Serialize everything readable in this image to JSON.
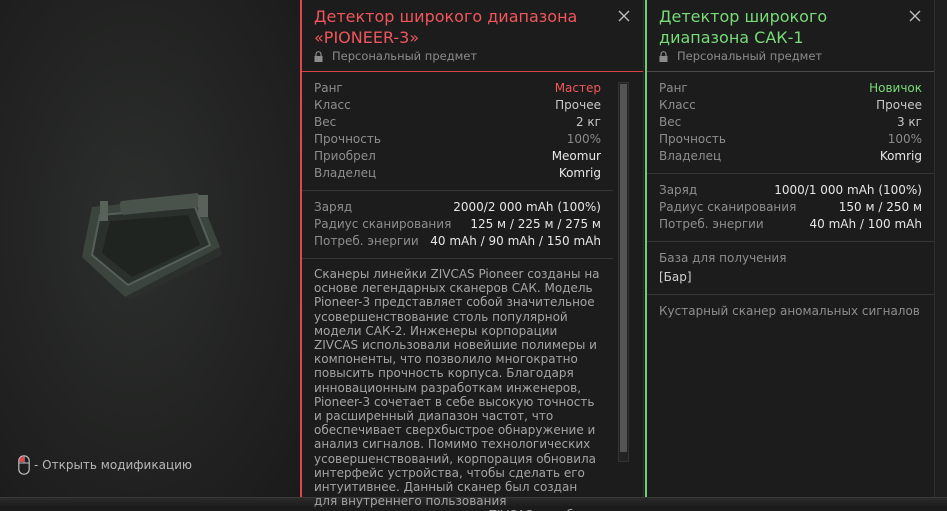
{
  "hint": {
    "text": "- Открыть модификацию"
  },
  "panel_a": {
    "title": "Детектор широкого диапазона «PIONEER-3»",
    "personal": "Персональный предмет",
    "stats1": [
      {
        "k": "Ранг",
        "v": "Мастер",
        "tone": "red"
      },
      {
        "k": "Класс",
        "v": "Прочее",
        "tone": "normal"
      },
      {
        "k": "Вес",
        "v": "2 кг",
        "tone": "normal"
      },
      {
        "k": "Прочность",
        "v": "100%",
        "tone": "dim"
      },
      {
        "k": "Приобрел",
        "v": "Meomur",
        "tone": "bright"
      },
      {
        "k": "Владелец",
        "v": "Komrig",
        "tone": "bright"
      }
    ],
    "stats2": [
      {
        "k": "Заряд",
        "v": "2000/2 000 mAh (100%)"
      },
      {
        "k": "Радиус сканирования",
        "v": "125 м / 225 м / 275 м"
      },
      {
        "k": "Потреб. энергии",
        "v": "40 mAh / 90 mAh / 150 mAh"
      }
    ],
    "description": "Сканеры линейки ZIVCAS Pioneer созданы на основе легендарных сканеров САК. Модель Pioneer-3 представляет собой значительное усовершенствование столь популярной модели САК-2. Инженеры корпорации ZIVCAS использовали новейшие полимеры и компоненты, что позволило многократно повысить прочность корпуса. Благодаря инновационным разработкам инженеров, Pioneer-3 сочетает в себе высокую точность и расширенный диапазон частот, что обеспечивает сверхбыстрое обнаружение и анализ сигналов. Помимо технологических усовершенствований, корпорация обновила интерфейс устройства, чтобы сделать его интуитивнее. Данный сканер был создан для внутреннего пользования сотрудниками корпорации ZIVCAS и любое его использование"
  },
  "panel_b": {
    "title": "Детектор широкого диапазона САК-1",
    "personal": "Персональный предмет",
    "stats1": [
      {
        "k": "Ранг",
        "v": "Новичок",
        "tone": "green"
      },
      {
        "k": "Класс",
        "v": "Прочее",
        "tone": "normal"
      },
      {
        "k": "Вес",
        "v": "3 кг",
        "tone": "normal"
      },
      {
        "k": "Прочность",
        "v": "100%",
        "tone": "dim"
      },
      {
        "k": "Владелец",
        "v": "Komrig",
        "tone": "bright"
      }
    ],
    "stats2": [
      {
        "k": "Заряд",
        "v": "1000/1 000 mAh (100%)"
      },
      {
        "k": "Радиус сканирования",
        "v": "150 м / 250 м"
      },
      {
        "k": "Потреб. энергии",
        "v": "40 mAh / 100 mAh"
      }
    ],
    "base_label": "База для получения",
    "base_value": "[Бар]",
    "note": "Кустарный сканер аномальных сигналов"
  },
  "colors": {
    "rank_master": "#f0565b",
    "rank_novice": "#78db78"
  }
}
